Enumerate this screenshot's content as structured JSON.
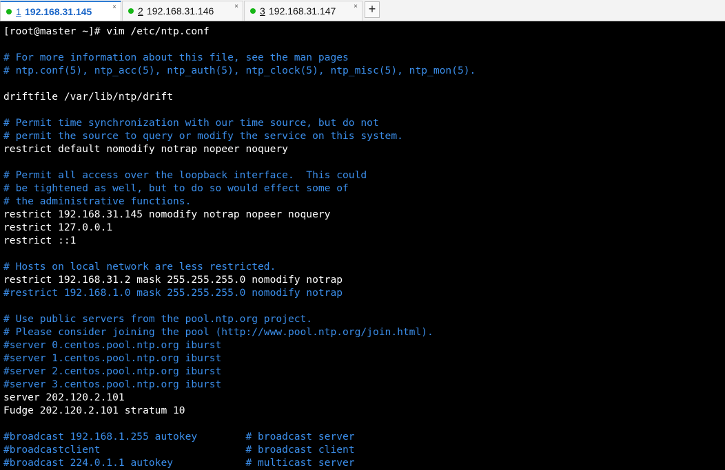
{
  "colors": {
    "terminal_bg": "#000000",
    "text": "#ffffff",
    "comment": "#3b8eea",
    "session_dot": "#16b616",
    "active_tab_text": "#1a66c8"
  },
  "tabs": [
    {
      "number": "1",
      "label": "192.168.31.145",
      "active": true,
      "status_icon": "connected-dot-icon",
      "close": "×"
    },
    {
      "number": "2",
      "label": "192.168.31.146",
      "active": false,
      "status_icon": "connected-dot-icon",
      "close": "×"
    },
    {
      "number": "3",
      "label": "192.168.31.147",
      "active": false,
      "status_icon": "connected-dot-icon",
      "close": "×"
    }
  ],
  "new_tab_label": "+",
  "terminal": {
    "lines": [
      {
        "text": "[root@master ~]# vim /etc/ntp.conf",
        "type": "text"
      },
      {
        "text": "",
        "type": "text"
      },
      {
        "text": "# For more information about this file, see the man pages",
        "type": "comment"
      },
      {
        "text": "# ntp.conf(5), ntp_acc(5), ntp_auth(5), ntp_clock(5), ntp_misc(5), ntp_mon(5).",
        "type": "comment"
      },
      {
        "text": "",
        "type": "text"
      },
      {
        "text": "driftfile /var/lib/ntp/drift",
        "type": "text"
      },
      {
        "text": "",
        "type": "text"
      },
      {
        "text": "# Permit time synchronization with our time source, but do not",
        "type": "comment"
      },
      {
        "text": "# permit the source to query or modify the service on this system.",
        "type": "comment"
      },
      {
        "text": "restrict default nomodify notrap nopeer noquery",
        "type": "text"
      },
      {
        "text": "",
        "type": "text"
      },
      {
        "text": "# Permit all access over the loopback interface.  This could",
        "type": "comment"
      },
      {
        "text": "# be tightened as well, but to do so would effect some of",
        "type": "comment"
      },
      {
        "text": "# the administrative functions.",
        "type": "comment"
      },
      {
        "text": "restrict 192.168.31.145 nomodify notrap nopeer noquery",
        "type": "text"
      },
      {
        "text": "restrict 127.0.0.1",
        "type": "text"
      },
      {
        "text": "restrict ::1",
        "type": "text"
      },
      {
        "text": "",
        "type": "text"
      },
      {
        "text": "# Hosts on local network are less restricted.",
        "type": "comment"
      },
      {
        "text": "restrict 192.168.31.2 mask 255.255.255.0 nomodify notrap",
        "type": "text"
      },
      {
        "text": "#restrict 192.168.1.0 mask 255.255.255.0 nomodify notrap",
        "type": "comment"
      },
      {
        "text": "",
        "type": "text"
      },
      {
        "text": "# Use public servers from the pool.ntp.org project.",
        "type": "comment"
      },
      {
        "text": "# Please consider joining the pool (http://www.pool.ntp.org/join.html).",
        "type": "comment"
      },
      {
        "text": "#server 0.centos.pool.ntp.org iburst",
        "type": "comment"
      },
      {
        "text": "#server 1.centos.pool.ntp.org iburst",
        "type": "comment"
      },
      {
        "text": "#server 2.centos.pool.ntp.org iburst",
        "type": "comment"
      },
      {
        "text": "#server 3.centos.pool.ntp.org iburst",
        "type": "comment"
      },
      {
        "text": "server 202.120.2.101",
        "type": "text"
      },
      {
        "text": "Fudge 202.120.2.101 stratum 10",
        "type": "text"
      },
      {
        "text": "",
        "type": "text"
      },
      {
        "text": "#broadcast 192.168.1.255 autokey        # broadcast server",
        "type": "comment"
      },
      {
        "text": "#broadcastclient                        # broadcast client",
        "type": "comment"
      },
      {
        "text": "#broadcast 224.0.1.1 autokey            # multicast server",
        "type": "comment"
      }
    ]
  }
}
